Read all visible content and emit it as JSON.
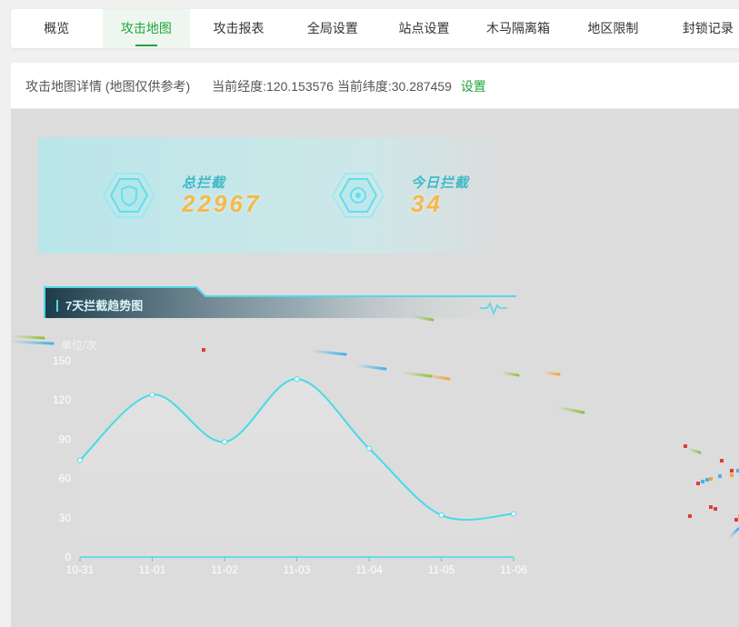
{
  "tabs": [
    {
      "label": "概览",
      "active": false
    },
    {
      "label": "攻击地图",
      "active": true
    },
    {
      "label": "攻击报表",
      "active": false
    },
    {
      "label": "全局设置",
      "active": false
    },
    {
      "label": "站点设置",
      "active": false
    },
    {
      "label": "木马隔离箱",
      "active": false
    },
    {
      "label": "地区限制",
      "active": false
    },
    {
      "label": "封锁记录",
      "active": false
    }
  ],
  "panel": {
    "title": "攻击地图详情 (地图仅供参考)",
    "coordinates": "当前经度:120.153576 当前纬度:30.287459",
    "settings_link": "设置"
  },
  "stats": {
    "total_label": "总拦截",
    "total_value": "22967",
    "today_label": "今日拦截",
    "today_value": "34"
  },
  "chart_header": {
    "title": "7天拦截趋势图",
    "unit": "单位/次"
  },
  "colors": {
    "accent": "#20a53a",
    "line": "#45dbe8",
    "stat_label": "#3fb9c9",
    "stat_value": "#f7b84b",
    "map_bg": "#dcdcdc"
  },
  "icons": [
    "shield-icon",
    "target-shield-icon",
    "pulse-icon"
  ],
  "chart_data": {
    "type": "line",
    "categories": [
      "10-31",
      "11-01",
      "11-02",
      "11-03",
      "11-04",
      "11-05",
      "11-06"
    ],
    "series": [
      {
        "values": [
          74,
          124,
          88,
          136,
          83,
          32,
          33
        ]
      }
    ],
    "ylim": [
      0,
      150
    ],
    "yticks": [
      0,
      30,
      60,
      90,
      120,
      150
    ],
    "smooth": true,
    "area_fill": true,
    "grid": false
  }
}
